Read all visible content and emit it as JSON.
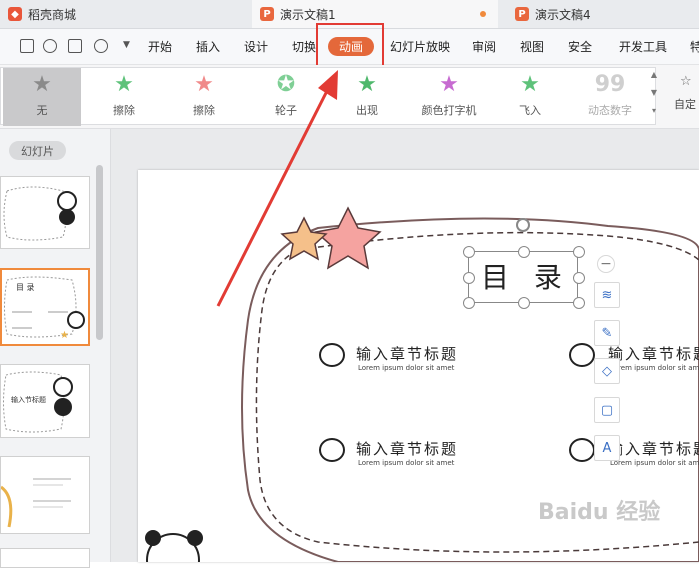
{
  "tabs": [
    {
      "label": "稻壳商城",
      "icon": "docer-icon"
    },
    {
      "label": "演示文稿1",
      "icon": "ppt-icon",
      "active": true,
      "unsaved": true
    },
    {
      "label": "演示文稿4",
      "icon": "ppt-icon"
    }
  ],
  "menu": {
    "items": [
      "开始",
      "插入",
      "设计",
      "切换",
      "动画",
      "幻灯片放映",
      "审阅",
      "视图",
      "安全",
      "开发工具",
      "特"
    ],
    "active": "动画"
  },
  "animations": [
    {
      "label": "无",
      "icon": "star-gray-icon"
    },
    {
      "label": "擦除",
      "icon": "star-green-icon"
    },
    {
      "label": "擦除",
      "icon": "star-red-icon"
    },
    {
      "label": "轮子",
      "icon": "star-wheel-icon"
    },
    {
      "label": "出现",
      "icon": "star-green-icon"
    },
    {
      "label": "颜色打字机",
      "icon": "star-multicolor-icon"
    },
    {
      "label": "飞入",
      "icon": "star-fly-icon"
    },
    {
      "label": "动态数字",
      "icon": "number-99-icon"
    }
  ],
  "ribbon_right": {
    "label": "自定"
  },
  "sidebar": {
    "label": "幻灯片"
  },
  "slide": {
    "title": "目 录",
    "sections": [
      {
        "title": "输入章节标题",
        "subtitle": "Lorem ipsum dolor sit amet"
      },
      {
        "title": "输入章节标题",
        "subtitle": "Lorem ipsum dolor sit amet"
      },
      {
        "title": "输入章节标题",
        "subtitle": "Lorem ipsum dolor sit amet"
      },
      {
        "title": "输入章节标题",
        "subtitle": "Lorem ipsum dolor sit amet"
      }
    ]
  },
  "thumbnails": [
    {
      "title": "",
      "selected": false
    },
    {
      "title": "目 录",
      "selected": true
    },
    {
      "title": "输入节标题",
      "selected": false
    },
    {
      "title": "",
      "selected": false
    },
    {
      "title": "",
      "selected": false
    }
  ],
  "floating_tools": [
    "minus-icon",
    "layers-icon",
    "brush-icon",
    "fill-icon",
    "frame-icon",
    "text-format-icon"
  ],
  "watermark": "Baidu 经验",
  "colors": {
    "accent": "#e4683a",
    "highlight": "#e23b34",
    "selection": "#f08a3c"
  }
}
